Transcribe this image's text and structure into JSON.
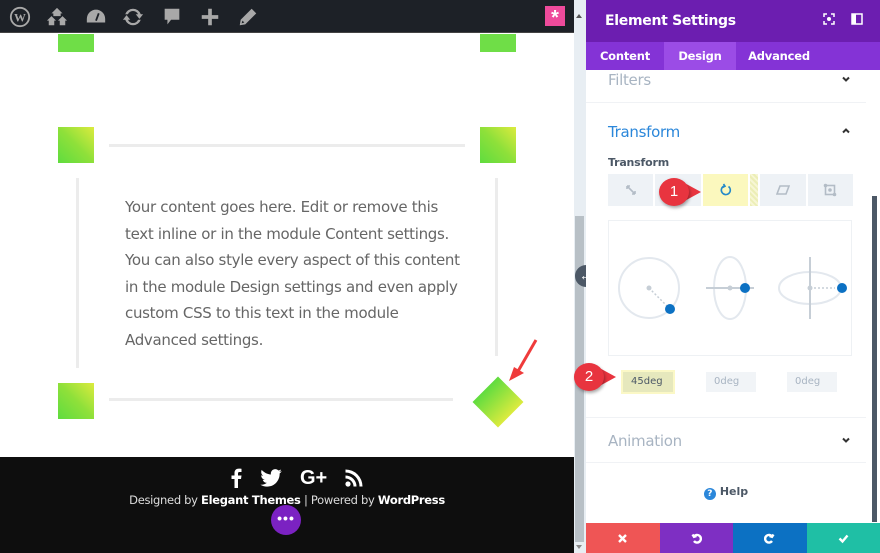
{
  "adminbar": {
    "icons": [
      "wordpress-icon",
      "my-sites-icon",
      "dashboard-icon",
      "updates-icon",
      "comments-icon",
      "new-content-icon",
      "edit-icon"
    ],
    "divi_icon": "*"
  },
  "canvas": {
    "content_text": "Your content goes here. Edit or remove this text inline or in the module Content settings. You can also style every aspect of this content in the module Design settings and even apply custom CSS to this text in the module Advanced settings.",
    "colors": {
      "gradient_start": "#5fdc3f",
      "gradient_end": "#dceb3e"
    }
  },
  "footer": {
    "social": [
      "facebook",
      "twitter",
      "google-plus",
      "rss"
    ],
    "google_plus_label": "G+",
    "credits_prefix": "Designed by ",
    "credits_brand": "Elegant Themes",
    "credits_sep": " | Powered by ",
    "credits_platform": "WordPress",
    "more_button": "•••"
  },
  "panel": {
    "title": "Element Settings",
    "tabs": [
      {
        "label": "Content",
        "active": false
      },
      {
        "label": "Design",
        "active": true
      },
      {
        "label": "Advanced",
        "active": false
      }
    ],
    "sections": {
      "filters": "Filters",
      "transform": "Transform",
      "animation": "Animation"
    },
    "transform_label": "Transform",
    "transform_tabs": [
      "scale",
      "rotate",
      "skew",
      "origin"
    ],
    "active_transform_tab": "rotate",
    "rotation": {
      "z": "45deg",
      "x": "0deg",
      "y": "0deg"
    },
    "help": "Help",
    "footer_buttons": [
      "discard",
      "undo",
      "redo",
      "save"
    ],
    "colors": {
      "header": "#6c1eb0",
      "tabs": "#8433d6",
      "accent": "#2b87da",
      "discard": "#ef5555",
      "undo": "#7e2fc3",
      "redo": "#0c71c3",
      "save": "#1fbfa5"
    }
  },
  "callouts": [
    "1",
    "2"
  ]
}
